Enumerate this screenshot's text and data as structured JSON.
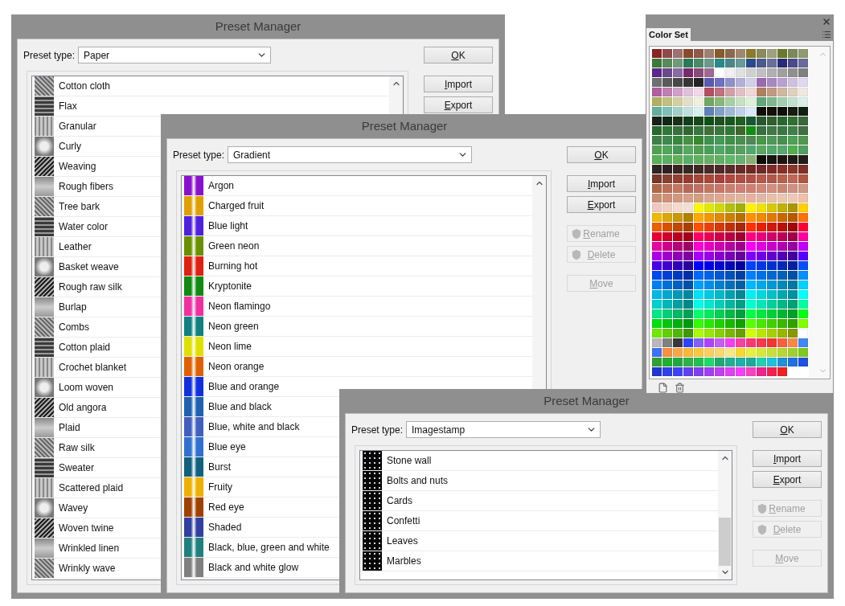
{
  "windows": [
    {
      "title": "Preset Manager",
      "preset_label": "Preset type:",
      "preset_value": "Paper",
      "kind": "texture",
      "items": [
        {
          "name": "Cotton cloth"
        },
        {
          "name": "Flax"
        },
        {
          "name": "Granular"
        },
        {
          "name": "Curly"
        },
        {
          "name": "Weaving"
        },
        {
          "name": "Rough fibers"
        },
        {
          "name": "Tree bark"
        },
        {
          "name": "Water color"
        },
        {
          "name": "Leather"
        },
        {
          "name": "Basket weave"
        },
        {
          "name": "Rough raw silk"
        },
        {
          "name": "Burlap"
        },
        {
          "name": "Combs"
        },
        {
          "name": "Cotton plaid"
        },
        {
          "name": "Crochet blanket"
        },
        {
          "name": "Loom woven"
        },
        {
          "name": "Old angora"
        },
        {
          "name": "Plaid"
        },
        {
          "name": "Raw silk"
        },
        {
          "name": "Sweater"
        },
        {
          "name": "Scattered plaid"
        },
        {
          "name": "Wavey"
        },
        {
          "name": "Woven twine"
        },
        {
          "name": "Wrinkled linen"
        },
        {
          "name": "Wrinkly wave"
        }
      ],
      "button_groups": [
        [
          {
            "label": "OK",
            "disabled": false,
            "shield": false
          }
        ],
        [
          {
            "label": "Import",
            "disabled": false,
            "shield": false
          },
          {
            "label": "Export",
            "disabled": false,
            "shield": false
          }
        ]
      ]
    },
    {
      "title": "Preset Manager",
      "preset_label": "Preset type:",
      "preset_value": "Gradient",
      "kind": "gradient",
      "items": [
        {
          "name": "Argon",
          "color": "#8a10d0"
        },
        {
          "name": "Charged fruit",
          "color": "#e0a000"
        },
        {
          "name": "Blue light",
          "color": "#5020e0"
        },
        {
          "name": "Green neon",
          "color": "#6a9000"
        },
        {
          "name": "Burning hot",
          "color": "#e02010"
        },
        {
          "name": "Kryptonite",
          "color": "#108a10"
        },
        {
          "name": "Neon flamingo",
          "color": "#f030a0"
        },
        {
          "name": "Neon green",
          "color": "#108080"
        },
        {
          "name": "Neon lime",
          "color": "#e0e000"
        },
        {
          "name": "Neon orange",
          "color": "#e06000"
        },
        {
          "name": "Blue and orange",
          "color": "#1030e0"
        },
        {
          "name": "Blue and black",
          "color": "#2060b0"
        },
        {
          "name": "Blue, white and black",
          "color": "#4060c0"
        },
        {
          "name": "Blue eye",
          "color": "#3070d0"
        },
        {
          "name": "Burst",
          "color": "#106080"
        },
        {
          "name": "Fruity",
          "color": "#f0b000"
        },
        {
          "name": "Red eye",
          "color": "#a04000"
        },
        {
          "name": "Shaded",
          "color": "#3040a0"
        },
        {
          "name": "Black, blue, green and white",
          "color": "#208080"
        },
        {
          "name": "Black and white glow",
          "color": "#808080"
        }
      ],
      "button_groups": [
        [
          {
            "label": "OK",
            "disabled": false,
            "shield": false
          }
        ],
        [
          {
            "label": "Import",
            "disabled": false,
            "shield": false
          },
          {
            "label": "Export",
            "disabled": false,
            "shield": false
          }
        ],
        [
          {
            "label": "Rename",
            "disabled": true,
            "shield": true
          },
          {
            "label": "Delete",
            "disabled": true,
            "shield": true
          }
        ],
        [
          {
            "label": "Move",
            "disabled": true,
            "shield": false
          }
        ]
      ]
    },
    {
      "title": "Preset Manager",
      "preset_label": "Preset type:",
      "preset_value": "Imagestamp",
      "kind": "stamp",
      "items": [
        {
          "name": "Stone wall"
        },
        {
          "name": "Bolts and nuts"
        },
        {
          "name": "Cards"
        },
        {
          "name": "Confetti"
        },
        {
          "name": "Leaves"
        },
        {
          "name": "Marbles"
        }
      ],
      "button_groups": [
        [
          {
            "label": "OK",
            "disabled": false,
            "shield": false
          }
        ],
        [
          {
            "label": "Import",
            "disabled": false,
            "shield": false
          },
          {
            "label": "Export",
            "disabled": false,
            "shield": false
          }
        ],
        [
          {
            "label": "Rename",
            "disabled": true,
            "shield": true
          },
          {
            "label": "Delete",
            "disabled": true,
            "shield": true
          }
        ],
        [
          {
            "label": "Move",
            "disabled": true,
            "shield": false
          }
        ]
      ]
    }
  ],
  "color_set": {
    "tab": "Color Set",
    "rows": [
      [
        {
          "color": "#8b2323"
        },
        {
          "color": "#8e4a4a"
        },
        {
          "color": "#a07070"
        },
        {
          "color": "#8a4a2a"
        },
        {
          "color": "#8f5a4a"
        },
        {
          "color": "#a08070"
        },
        {
          "color": "#8a5a2a"
        },
        {
          "color": "#8a6a4a"
        },
        {
          "color": "#a08870"
        },
        {
          "color": "#8a7a2a"
        },
        {
          "color": "#8a8a5a"
        },
        {
          "color": "#a0a080"
        },
        {
          "color": "#6a7a2a"
        },
        {
          "color": "#7a8a5a"
        },
        {
          "color": "#909a70"
        }
      ],
      [
        {
          "color": "#3a7a3a"
        },
        {
          "color": "#5a8a5a"
        },
        {
          "color": "#709a7a"
        },
        {
          "color": "#2a7a5a"
        },
        {
          "color": "#4a8a6a"
        },
        {
          "color": "#6a9a8a"
        },
        {
          "color": "#2a8a8a"
        },
        {
          "color": "#4a8888"
        },
        {
          "color": "#6a9a9a"
        },
        {
          "color": "#2a4a8a"
        },
        {
          "color": "#4a5a8a"
        },
        {
          "color": "#6a709a"
        },
        {
          "color": "#2a2a7a"
        },
        {
          "color": "#4a4a8a"
        },
        {
          "color": "#6a6a9a"
        }
      ],
      [
        {
          "color": "#5a2a8a"
        },
        {
          "color": "#6a4a8a"
        },
        {
          "color": "#8a6aa0"
        },
        {
          "color": "#7a2a6a"
        },
        {
          "color": "#8a4a7a"
        },
        {
          "color": "#a06a90"
        },
        {
          "color": "#ffffff"
        },
        {
          "color": "#f0f0f0"
        },
        {
          "color": "#e0e0e0"
        },
        {
          "color": "#d0d0d0"
        },
        {
          "color": "#c0c0c0"
        },
        {
          "color": "#b0b0b0"
        },
        {
          "color": "#a0a0a0"
        },
        {
          "color": "#909090"
        },
        {
          "color": "#808080"
        }
      ],
      [
        {
          "color": "#707070"
        },
        {
          "color": "#5a5a5a"
        },
        {
          "color": "#484848"
        },
        {
          "color": "#363636"
        },
        {
          "color": "#242424"
        },
        {
          "color": "#5a5ab0"
        },
        {
          "color": "#7070c0"
        },
        {
          "color": "#9090c8"
        },
        {
          "color": "#b0b0d8"
        },
        {
          "color": "#d0d0e8"
        },
        {
          "color": "#9a6ab0"
        },
        {
          "color": "#a888c0"
        },
        {
          "color": "#b8a0d0"
        },
        {
          "color": "#d0c0e0"
        },
        {
          "color": "#e0d8f0"
        }
      ],
      [
        {
          "color": "#b060a0"
        },
        {
          "color": "#c080b0"
        },
        {
          "color": "#d0a0c8"
        },
        {
          "color": "#e0c0d8"
        },
        {
          "color": "#f0d8e8"
        },
        {
          "color": "#b05060"
        },
        {
          "color": "#c07080"
        },
        {
          "color": "#d0a0a8"
        },
        {
          "color": "#e0c0c8"
        },
        {
          "color": "#f0d8d8"
        },
        {
          "color": "#b08060"
        },
        {
          "color": "#c09a80"
        },
        {
          "color": "#d0b8a0"
        },
        {
          "color": "#e0d0c0"
        },
        {
          "color": "#f0e8e0"
        }
      ],
      [
        {
          "color": "#b0b060"
        },
        {
          "color": "#c0c080"
        },
        {
          "color": "#d0d0a0"
        },
        {
          "color": "#e0e0c8"
        },
        {
          "color": "#f0f0e0"
        },
        {
          "color": "#70a860"
        },
        {
          "color": "#88b878"
        },
        {
          "color": "#a8d0a0"
        },
        {
          "color": "#c8e0c0"
        },
        {
          "color": "#e0f0d8"
        },
        {
          "color": "#60a878"
        },
        {
          "color": "#80b890"
        },
        {
          "color": "#a0d0b0"
        },
        {
          "color": "#c0e0d0"
        },
        {
          "color": "#d8f0e8"
        }
      ],
      [
        {
          "color": "#60b0a0"
        },
        {
          "color": "#80c0b8"
        },
        {
          "color": "#a0d0c8"
        },
        {
          "color": "#c0e0e0"
        },
        {
          "color": "#d8f0f0"
        },
        {
          "color": "#6080b8"
        },
        {
          "color": "#80a0c8"
        },
        {
          "color": "#a0b8d8"
        },
        {
          "color": "#c0d0e8"
        },
        {
          "color": "#d8e8f8"
        },
        {
          "color": "#101008"
        },
        {
          "color": "#121208"
        },
        {
          "color": "#101008"
        },
        {
          "color": "#181c10"
        },
        {
          "color": "#102010"
        }
      ],
      [
        {
          "color": "#182018"
        },
        {
          "color": "#102818"
        },
        {
          "color": "#183018"
        },
        {
          "color": "#104018"
        },
        {
          "color": "#184818"
        },
        {
          "color": "#105018"
        },
        {
          "color": "#205020"
        },
        {
          "color": "#185820"
        },
        {
          "color": "#206020"
        },
        {
          "color": "#185830"
        },
        {
          "color": "#285830"
        },
        {
          "color": "#306030"
        },
        {
          "color": "#286830"
        },
        {
          "color": "#307030"
        },
        {
          "color": "#386838"
        }
      ],
      [
        {
          "color": "#286830"
        },
        {
          "color": "#307838"
        },
        {
          "color": "#387040"
        },
        {
          "color": "#306830"
        },
        {
          "color": "#387840"
        },
        {
          "color": "#407038"
        },
        {
          "color": "#387840"
        },
        {
          "color": "#307838"
        },
        {
          "color": "#406828"
        },
        {
          "color": "#109010"
        },
        {
          "color": "#387040"
        },
        {
          "color": "#407848"
        },
        {
          "color": "#387840"
        },
        {
          "color": "#408048"
        },
        {
          "color": "#407040"
        }
      ],
      [
        {
          "color": "#408048"
        },
        {
          "color": "#408850"
        },
        {
          "color": "#388840"
        },
        {
          "color": "#489048"
        },
        {
          "color": "#3a8830"
        },
        {
          "color": "#409050"
        },
        {
          "color": "#489858"
        },
        {
          "color": "#409048"
        },
        {
          "color": "#489050"
        },
        {
          "color": "#508858"
        },
        {
          "color": "#489848"
        },
        {
          "color": "#509858"
        },
        {
          "color": "#489050"
        },
        {
          "color": "#50a058"
        },
        {
          "color": "#509850"
        }
      ],
      [
        {
          "color": "#50a050"
        },
        {
          "color": "#50a858"
        },
        {
          "color": "#489858"
        },
        {
          "color": "#58a860"
        },
        {
          "color": "#52a052"
        },
        {
          "color": "#48a058"
        },
        {
          "color": "#50a868"
        },
        {
          "color": "#4aa05a"
        },
        {
          "color": "#58a060"
        },
        {
          "color": "#50a870"
        },
        {
          "color": "#5aa862"
        },
        {
          "color": "#52a86a"
        },
        {
          "color": "#58a870"
        },
        {
          "color": "#50b050"
        },
        {
          "color": "#50a060"
        }
      ],
      [
        {
          "color": "#58b058"
        },
        {
          "color": "#58b060"
        },
        {
          "color": "#60b058"
        },
        {
          "color": "#58b068"
        },
        {
          "color": "#60b060"
        },
        {
          "color": "#68b068"
        },
        {
          "color": "#62b062"
        },
        {
          "color": "#60b868"
        },
        {
          "color": "#68b070"
        },
        {
          "color": "#88b070"
        },
        {
          "color": "#100c08"
        },
        {
          "color": "#181410"
        },
        {
          "color": "#201410"
        },
        {
          "color": "#201a14"
        },
        {
          "color": "#241c18"
        }
      ],
      [
        {
          "color": "#302422"
        },
        {
          "color": "#302020"
        },
        {
          "color": "#382420"
        },
        {
          "color": "#382824"
        },
        {
          "color": "#402824"
        },
        {
          "color": "#482a28"
        },
        {
          "color": "#502828"
        },
        {
          "color": "#582a28"
        },
        {
          "color": "#682a28"
        },
        {
          "color": "#702820"
        },
        {
          "color": "#702a28"
        },
        {
          "color": "#802a28"
        },
        {
          "color": "#883028"
        },
        {
          "color": "#883828"
        },
        {
          "color": "#803028"
        }
      ],
      [
        {
          "color": "#783828"
        },
        {
          "color": "#884030"
        },
        {
          "color": "#904030"
        },
        {
          "color": "#983a30"
        },
        {
          "color": "#a04838"
        },
        {
          "color": "#a84838"
        },
        {
          "color": "#a84040"
        },
        {
          "color": "#b04840"
        },
        {
          "color": "#b05040"
        },
        {
          "color": "#b05048"
        },
        {
          "color": "#b85848"
        },
        {
          "color": "#b05848"
        },
        {
          "color": "#b86050"
        },
        {
          "color": "#c06858"
        },
        {
          "color": "#b05840"
        }
      ],
      [
        {
          "color": "#b06848"
        },
        {
          "color": "#b87058"
        },
        {
          "color": "#c07860"
        },
        {
          "color": "#b86858"
        },
        {
          "color": "#c07068"
        },
        {
          "color": "#c07862"
        },
        {
          "color": "#c87868"
        },
        {
          "color": "#c88070"
        },
        {
          "color": "#d08078"
        },
        {
          "color": "#d08070"
        },
        {
          "color": "#d08878"
        },
        {
          "color": "#d09080"
        },
        {
          "color": "#c88870"
        },
        {
          "color": "#d09082"
        },
        {
          "color": "#d09888"
        }
      ],
      [
        {
          "color": "#c89070"
        },
        {
          "color": "#d09078"
        },
        {
          "color": "#d09880"
        },
        {
          "color": "#d8a088"
        },
        {
          "color": "#d0a080"
        },
        {
          "color": "#d8a890"
        },
        {
          "color": "#e0a890"
        },
        {
          "color": "#e0b098"
        },
        {
          "color": "#e0b8a0"
        },
        {
          "color": "#e8b0a0"
        },
        {
          "color": "#e0b8a8"
        },
        {
          "color": "#e8c0a8"
        },
        {
          "color": "#e8c8b0"
        },
        {
          "color": "#f0c8b8"
        },
        {
          "color": "#f0c0a8"
        }
      ],
      [
        {
          "color": "#f0c8c0"
        },
        {
          "color": "#f0d0c0"
        },
        {
          "color": "#f8d8d0"
        },
        {
          "color": "#f0e0d8"
        },
        {
          "color": "#f8f808"
        },
        {
          "color": "#e0e808"
        },
        {
          "color": "#d0d808"
        },
        {
          "color": "#b0c010"
        },
        {
          "color": "#a0b008"
        },
        {
          "color": "#fff008"
        },
        {
          "color": "#f0e008"
        },
        {
          "color": "#d8c808"
        },
        {
          "color": "#c0b008"
        },
        {
          "color": "#a89808"
        },
        {
          "color": "#ffd000"
        }
      ],
      [
        {
          "color": "#f0b800"
        },
        {
          "color": "#d8a808"
        },
        {
          "color": "#c89808"
        },
        {
          "color": "#b08000"
        },
        {
          "color": "#ffa800"
        },
        {
          "color": "#f09800"
        },
        {
          "color": "#e08808"
        },
        {
          "color": "#c88000"
        },
        {
          "color": "#b87000"
        },
        {
          "color": "#ff9000"
        },
        {
          "color": "#f08800"
        },
        {
          "color": "#e07808"
        },
        {
          "color": "#c86800"
        },
        {
          "color": "#b85800"
        },
        {
          "color": "#ff7000"
        }
      ],
      [
        {
          "color": "#e86000"
        },
        {
          "color": "#d85000"
        },
        {
          "color": "#c04800"
        },
        {
          "color": "#a84000"
        },
        {
          "color": "#ff5000"
        },
        {
          "color": "#e84008"
        },
        {
          "color": "#d83808"
        },
        {
          "color": "#c03008"
        },
        {
          "color": "#a82808"
        },
        {
          "color": "#ff3000"
        },
        {
          "color": "#e82000"
        },
        {
          "color": "#d01808"
        },
        {
          "color": "#b81008"
        },
        {
          "color": "#a00808"
        },
        {
          "color": "#ff0038"
        }
      ],
      [
        {
          "color": "#e80030"
        },
        {
          "color": "#d00028"
        },
        {
          "color": "#b80020"
        },
        {
          "color": "#a00018"
        },
        {
          "color": "#ff0060"
        },
        {
          "color": "#e80050"
        },
        {
          "color": "#d00048"
        },
        {
          "color": "#b80040"
        },
        {
          "color": "#a00030"
        },
        {
          "color": "#ff0080"
        },
        {
          "color": "#e80078"
        },
        {
          "color": "#d00068"
        },
        {
          "color": "#b80058"
        },
        {
          "color": "#a00048"
        },
        {
          "color": "#ff00a0"
        }
      ],
      [
        {
          "color": "#e800a0"
        },
        {
          "color": "#d00088"
        },
        {
          "color": "#b80078"
        },
        {
          "color": "#a00068"
        },
        {
          "color": "#ff00d0"
        },
        {
          "color": "#e800c0"
        },
        {
          "color": "#d000b0"
        },
        {
          "color": "#b800a0"
        },
        {
          "color": "#a00090"
        },
        {
          "color": "#f800f8"
        },
        {
          "color": "#e000e0"
        },
        {
          "color": "#c800c8"
        },
        {
          "color": "#b000b0"
        },
        {
          "color": "#9800a0"
        },
        {
          "color": "#c000ff"
        }
      ],
      [
        {
          "color": "#b000e8"
        },
        {
          "color": "#a000d0"
        },
        {
          "color": "#9000b8"
        },
        {
          "color": "#8000a0"
        },
        {
          "color": "#a800ff"
        },
        {
          "color": "#9800e8"
        },
        {
          "color": "#8800d0"
        },
        {
          "color": "#7800b8"
        },
        {
          "color": "#6800a0"
        },
        {
          "color": "#8000ff"
        },
        {
          "color": "#7000e8"
        },
        {
          "color": "#6000d0"
        },
        {
          "color": "#5000b8"
        },
        {
          "color": "#4000a0"
        },
        {
          "color": "#5800ff"
        }
      ],
      [
        {
          "color": "#4800e8"
        },
        {
          "color": "#4000d0"
        },
        {
          "color": "#3000b8"
        },
        {
          "color": "#2800a0"
        },
        {
          "color": "#0000ff"
        },
        {
          "color": "#0000e8"
        },
        {
          "color": "#0008d0"
        },
        {
          "color": "#0008b8"
        },
        {
          "color": "#0000a0"
        },
        {
          "color": "#0040ff"
        },
        {
          "color": "#0038e8"
        },
        {
          "color": "#0030d0"
        },
        {
          "color": "#0028b8"
        },
        {
          "color": "#0020a0"
        },
        {
          "color": "#0050ff"
        }
      ],
      [
        {
          "color": "#0048f0"
        },
        {
          "color": "#0040d8"
        },
        {
          "color": "#0038c0"
        },
        {
          "color": "#0030a8"
        },
        {
          "color": "#0068ff"
        },
        {
          "color": "#0060e8"
        },
        {
          "color": "#0058d0"
        },
        {
          "color": "#0050b8"
        },
        {
          "color": "#0040a0"
        },
        {
          "color": "#0080ff"
        },
        {
          "color": "#0070e8"
        },
        {
          "color": "#0068d0"
        },
        {
          "color": "#0060b8"
        },
        {
          "color": "#0050a0"
        },
        {
          "color": "#0090ff"
        }
      ],
      [
        {
          "color": "#0080f0"
        },
        {
          "color": "#0070d8"
        },
        {
          "color": "#0060c0"
        },
        {
          "color": "#0050a8"
        },
        {
          "color": "#00a0ff"
        },
        {
          "color": "#0090e8"
        },
        {
          "color": "#0080d0"
        },
        {
          "color": "#0070b8"
        },
        {
          "color": "#0060a0"
        },
        {
          "color": "#00b8ff"
        },
        {
          "color": "#00a8e8"
        },
        {
          "color": "#0098d0"
        },
        {
          "color": "#0088b8"
        },
        {
          "color": "#0078a0"
        },
        {
          "color": "#00d0ff"
        }
      ],
      [
        {
          "color": "#00b8e8"
        },
        {
          "color": "#00a8d0"
        },
        {
          "color": "#0098b8"
        },
        {
          "color": "#0088a0"
        },
        {
          "color": "#00e0f8"
        },
        {
          "color": "#00c8e0"
        },
        {
          "color": "#00b8c8"
        },
        {
          "color": "#00a0b0"
        },
        {
          "color": "#008898"
        },
        {
          "color": "#00f0f8"
        },
        {
          "color": "#00d8e0"
        },
        {
          "color": "#00c0c8"
        },
        {
          "color": "#00a8b0"
        },
        {
          "color": "#0090a0"
        },
        {
          "color": "#00ffff"
        }
      ],
      [
        {
          "color": "#00d0d0"
        },
        {
          "color": "#00b8b8"
        },
        {
          "color": "#00a0a0"
        },
        {
          "color": "#008888"
        },
        {
          "color": "#00ffe8"
        },
        {
          "color": "#00e8d0"
        },
        {
          "color": "#00d0b8"
        },
        {
          "color": "#00b8a0"
        },
        {
          "color": "#00a088"
        },
        {
          "color": "#00ffd0"
        },
        {
          "color": "#00e8b8"
        },
        {
          "color": "#00d0a0"
        },
        {
          "color": "#00b888"
        },
        {
          "color": "#00a078"
        },
        {
          "color": "#00ffa0"
        }
      ],
      [
        {
          "color": "#00e888"
        },
        {
          "color": "#00d078"
        },
        {
          "color": "#00b868"
        },
        {
          "color": "#00a058"
        },
        {
          "color": "#00ff70"
        },
        {
          "color": "#00e860"
        },
        {
          "color": "#00d058"
        },
        {
          "color": "#00b848"
        },
        {
          "color": "#00a040"
        },
        {
          "color": "#00ff48"
        },
        {
          "color": "#00e840"
        },
        {
          "color": "#00d038"
        },
        {
          "color": "#00b830"
        },
        {
          "color": "#00a028"
        },
        {
          "color": "#00ff10"
        }
      ],
      [
        {
          "color": "#00e010"
        },
        {
          "color": "#00c810"
        },
        {
          "color": "#00b010"
        },
        {
          "color": "#009810"
        },
        {
          "color": "#30ff00"
        },
        {
          "color": "#28e800"
        },
        {
          "color": "#20d000"
        },
        {
          "color": "#18b800"
        },
        {
          "color": "#10a000"
        },
        {
          "color": "#58ff00"
        },
        {
          "color": "#48e800"
        },
        {
          "color": "#40d000"
        },
        {
          "color": "#38b800"
        },
        {
          "color": "#30a000"
        },
        {
          "color": "#80ff00"
        }
      ],
      [
        {
          "color": "#70e800"
        },
        {
          "color": "#60d000"
        },
        {
          "color": "#50b800"
        },
        {
          "color": "#409800"
        },
        {
          "color": "#a8ff00"
        },
        {
          "color": "#98e800"
        },
        {
          "color": "#88d000"
        },
        {
          "color": "#78b800"
        },
        {
          "color": "#68a000"
        },
        {
          "color": "#d0ff00"
        },
        {
          "color": "#b8e800"
        },
        {
          "color": "#a8d000"
        },
        {
          "color": "#98b800"
        },
        {
          "color": "#889800"
        },
        {
          "color": "#ffffff"
        }
      ],
      [
        {
          "color": "#b8b8b8"
        },
        {
          "color": "#808080"
        },
        {
          "color": "#383838"
        },
        {
          "color": "#3040ff"
        },
        {
          "color": "#8060ff"
        },
        {
          "color": "#b040ff"
        },
        {
          "color": "#c060f0"
        },
        {
          "color": "#f040f0"
        },
        {
          "color": "#f840a0"
        },
        {
          "color": "#f83878"
        },
        {
          "color": "#f83850"
        },
        {
          "color": "#f03830"
        },
        {
          "color": "#f86040"
        },
        {
          "color": "#f88848"
        },
        {
          "color": "#4088f8"
        }
      ],
      [
        {
          "color": "#4070f8"
        },
        {
          "color": "#f89040"
        },
        {
          "color": "#f8a848"
        },
        {
          "color": "#f8b838"
        },
        {
          "color": "#f8c840"
        },
        {
          "color": "#f8d060"
        },
        {
          "color": "#f8d870"
        },
        {
          "color": "#f8e888"
        },
        {
          "color": "#f8d830"
        },
        {
          "color": "#e8f040"
        },
        {
          "color": "#d8e838"
        },
        {
          "color": "#c8e038"
        },
        {
          "color": "#b8d830"
        },
        {
          "color": "#a0d030"
        },
        {
          "color": "#80c820"
        }
      ],
      [
        {
          "color": "#30a030"
        },
        {
          "color": "#20b030"
        },
        {
          "color": "#20a840"
        },
        {
          "color": "#30b048"
        },
        {
          "color": "#20c050"
        },
        {
          "color": "#20d868"
        },
        {
          "color": "#20a870"
        },
        {
          "color": "#20b090"
        },
        {
          "color": "#20b0a8"
        },
        {
          "color": "#20a898"
        },
        {
          "color": "#20d0b0"
        },
        {
          "color": "#20c0d8"
        },
        {
          "color": "#2090d8"
        },
        {
          "color": "#2070e0"
        },
        {
          "color": "#2050e0"
        }
      ],
      [
        {
          "color": "#2038d0"
        },
        {
          "color": "#3040e8"
        },
        {
          "color": "#4040f8"
        },
        {
          "color": "#6040f0"
        },
        {
          "color": "#8040f0"
        },
        {
          "color": "#a040f0"
        },
        {
          "color": "#c040f0"
        },
        {
          "color": "#e040f0"
        },
        {
          "color": "#f840f8"
        },
        {
          "color": "#f840c0"
        },
        {
          "color": "#f02090"
        },
        {
          "color": "#f02050"
        },
        {
          "color": "#f02020"
        }
      ]
    ]
  }
}
